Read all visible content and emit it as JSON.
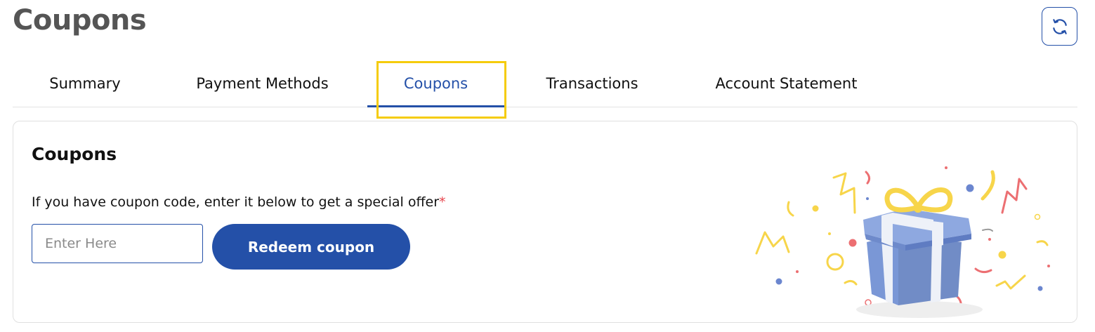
{
  "header": {
    "title": "Coupons",
    "refresh_icon": "refresh-icon"
  },
  "tabs": [
    {
      "label": "Summary",
      "active": false
    },
    {
      "label": "Payment Methods",
      "active": false
    },
    {
      "label": "Coupons",
      "active": true
    },
    {
      "label": "Transactions",
      "active": false
    },
    {
      "label": "Account Statement",
      "active": false
    }
  ],
  "card": {
    "title": "Coupons",
    "description": "If you have coupon code, enter it below to get a special offer",
    "required_mark": "*",
    "input": {
      "placeholder": "Enter Here",
      "value": ""
    },
    "redeem_label": "Redeem coupon",
    "illustration_icon": "gift-box-icon"
  },
  "colors": {
    "accent": "#2450a8",
    "highlight": "#f5cc0c",
    "required": "#e8474f",
    "gift": "#7a97d6",
    "confetti_yellow": "#f7d54a",
    "confetti_red": "#ec6f72"
  }
}
